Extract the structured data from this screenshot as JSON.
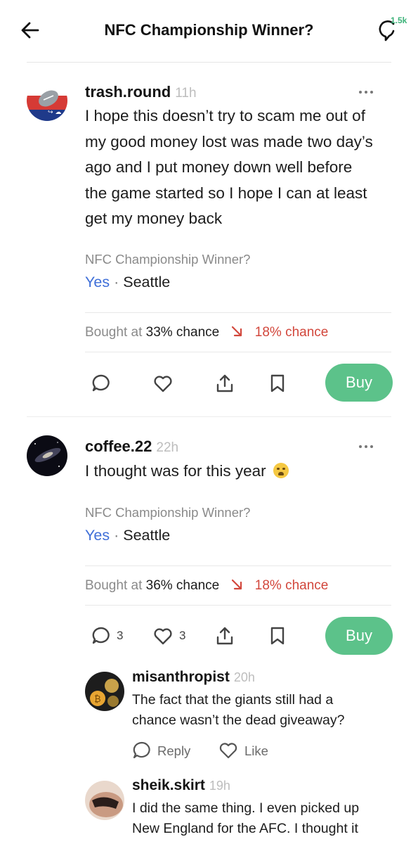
{
  "header": {
    "title": "NFC Championship Winner?",
    "comment_count": "1.5k"
  },
  "colors": {
    "accent_green": "#5cc28a",
    "yes_blue": "#3f6fd8",
    "down_red": "#d2473c"
  },
  "posts": [
    {
      "username": "trash.round",
      "time": "11h",
      "body_lines": [
        "I hope this doesn’t try to scam me out of",
        "my good money lost was made two day’s",
        "ago and I put money down well before",
        "the game started so I hope I can at least",
        "get my money back"
      ],
      "market_question": "NFC Championship Winner?",
      "market_side": "Yes",
      "market_team": "Seattle",
      "bought_label": "Bought at",
      "bought_value": "33% chance",
      "current_value": "18% chance",
      "buy_label": "Buy",
      "comment_count": "",
      "like_count": ""
    },
    {
      "username": "coffee.22",
      "time": "22h",
      "body_lines": [
        "I thought was for this year"
      ],
      "market_question": "NFC Championship Winner?",
      "market_side": "Yes",
      "market_team": "Seattle",
      "bought_label": "Bought at",
      "bought_value": "36% chance",
      "current_value": "18% chance",
      "buy_label": "Buy",
      "comment_count": "3",
      "like_count": "3"
    }
  ],
  "replies": [
    {
      "username": "misanthropist",
      "time": "20h",
      "lines": [
        "The fact that the giants still had a",
        "chance wasn’t the dead giveaway?"
      ],
      "reply_label": "Reply",
      "like_label": "Like"
    },
    {
      "username": "sheik.skirt",
      "time": "19h",
      "lines": [
        "I did the same thing. I even picked up",
        "New England for the AFC. I thought it"
      ]
    }
  ]
}
